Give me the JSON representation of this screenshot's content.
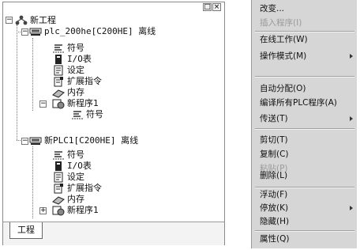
{
  "window_buttons": {
    "maximize": "□",
    "close": "×"
  },
  "tree": {
    "root": "新工程",
    "plc1": {
      "title": "plc_200he[C200HE] 离线",
      "items": [
        "符号",
        "I/O表",
        "设定",
        "扩展指令",
        "内存"
      ],
      "program": "新程序1",
      "program_child": "符号"
    },
    "plc2": {
      "title": "新PLC1[C200HE] 离线",
      "items": [
        "符号",
        "I/O表",
        "设定",
        "扩展指令",
        "内存"
      ],
      "program": "新程序1"
    }
  },
  "tab": {
    "label": "工程"
  },
  "context_menu": {
    "items": [
      {
        "label": "改变...",
        "disabled": false
      },
      {
        "label": "插入程序(I)",
        "disabled": true
      },
      {
        "label": "在线工作(W)",
        "disabled": false
      },
      {
        "label": "操作模式(M)",
        "disabled": false
      },
      {
        "label": "自动分配(O)",
        "disabled": false
      },
      {
        "label": "编译所有PLC程序(A)",
        "disabled": false
      },
      {
        "label": "传送(T)",
        "disabled": false
      },
      {
        "label": "剪切(T)",
        "disabled": false
      },
      {
        "label": "复制(C)",
        "disabled": false
      },
      {
        "label": "粘贴(P)",
        "disabled": true
      },
      {
        "label": "删除(L)",
        "disabled": false
      },
      {
        "label": "浮动(F)",
        "disabled": false
      },
      {
        "label": "停放(K)",
        "disabled": false
      },
      {
        "label": "隐藏(H)",
        "disabled": false
      },
      {
        "label": "属性(Q)",
        "disabled": false
      }
    ]
  }
}
